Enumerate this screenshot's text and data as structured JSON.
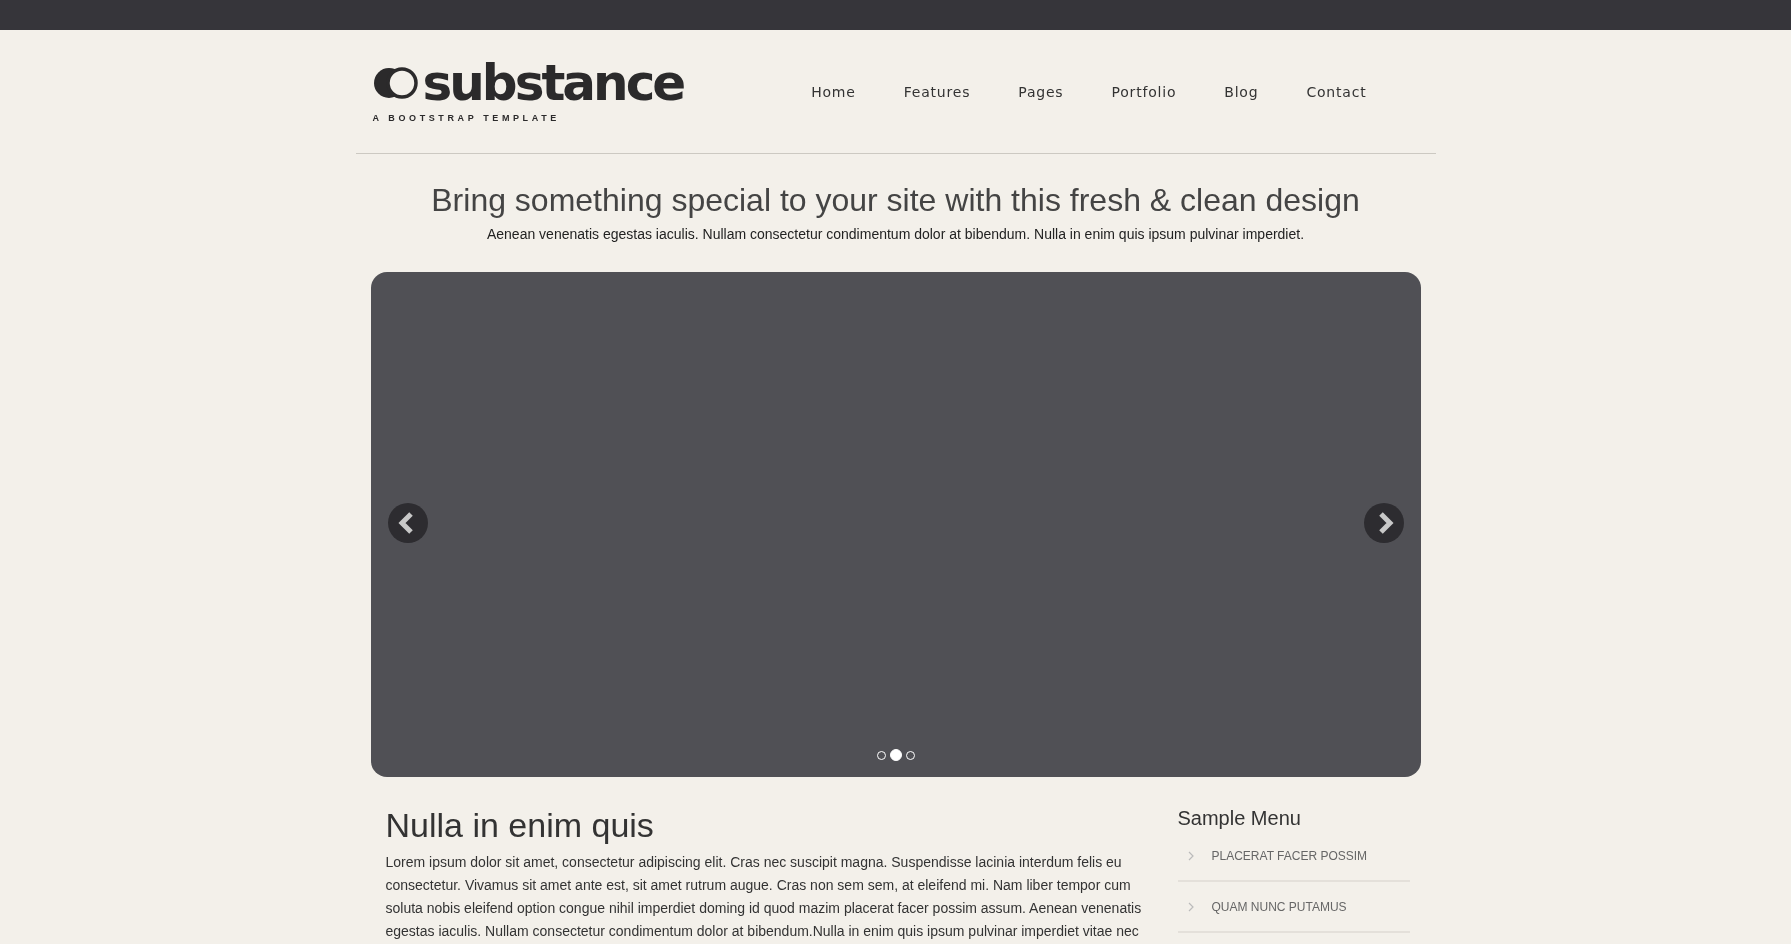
{
  "logo": {
    "name": "substance",
    "tagline": "A BOOTSTRAP TEMPLATE"
  },
  "nav": [
    {
      "label": "Home"
    },
    {
      "label": "Features"
    },
    {
      "label": "Pages"
    },
    {
      "label": "Portfolio"
    },
    {
      "label": "Blog"
    },
    {
      "label": "Contact"
    }
  ],
  "hero": {
    "title": "Bring something special to your site with this fresh & clean design",
    "subtitle": "Aenean venenatis egestas iaculis. Nullam consectetur condimentum dolor at bibendum. Nulla in enim quis ipsum pulvinar imperdiet."
  },
  "slider": {
    "indicators": [
      {
        "selected": false
      },
      {
        "selected": true
      },
      {
        "selected": false
      }
    ]
  },
  "article": {
    "title": "Nulla in enim quis",
    "body": "Lorem ipsum dolor sit amet, consectetur adipiscing elit. Cras nec suscipit magna. Suspendisse lacinia interdum felis eu consectetur. Vivamus sit amet ante est, sit amet rutrum augue. Cras non sem sem, at eleifend mi. Nam liber tempor cum soluta nobis eleifend option congue nihil imperdiet doming id quod mazim placerat facer possim assum. Aenean venenatis egestas iaculis. Nullam consectetur condimentum dolor at bibendum.Nulla in enim quis ipsum pulvinar imperdiet vitae nec"
  },
  "sidebar": {
    "title": "Sample Menu",
    "items": [
      {
        "label": "PLACERAT FACER POSSIM"
      },
      {
        "label": "QUAM NUNC PUTAMUS"
      }
    ]
  }
}
